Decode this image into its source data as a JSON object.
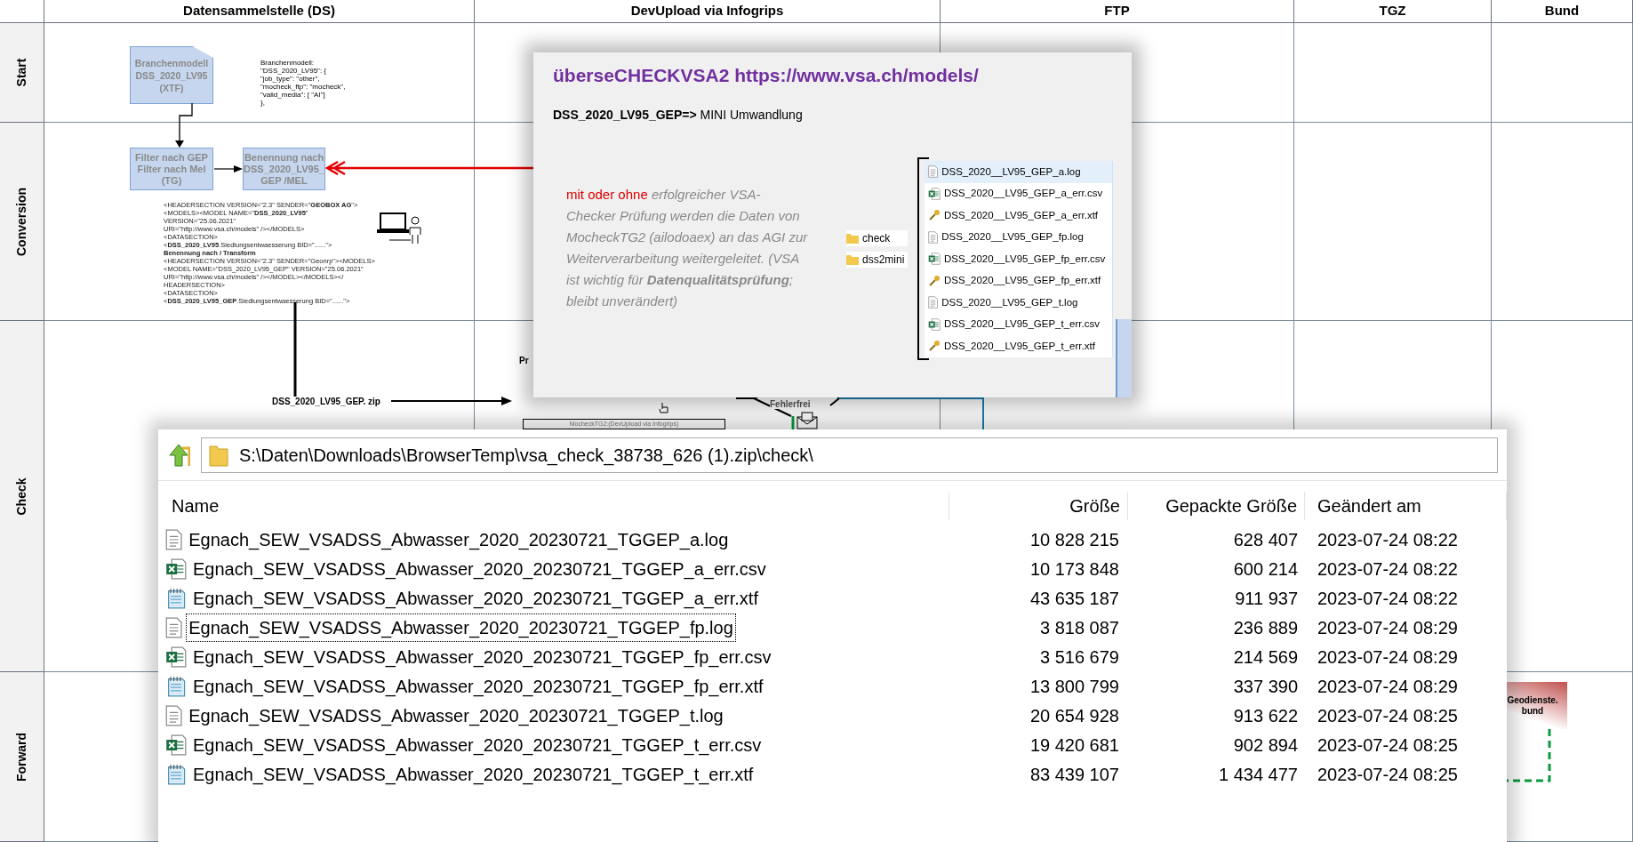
{
  "lanes": {
    "columns": [
      "Datensammelstelle (DS)",
      "DevUpload via Infogrips",
      "FTP",
      "TGZ",
      "Bund"
    ],
    "rows": [
      "Start",
      "Conversion",
      "Check",
      "Forward"
    ]
  },
  "start": {
    "document": [
      "Branchenmodell",
      "DSS_2020_LV95",
      "(XTF)"
    ],
    "config": [
      "Branchenmodell:",
      "\"DSS_2020_LV95\": {",
      "\"job_type\": \"other\",",
      "\"mocheck_ftp\": \"mocheck\",",
      "\"valid_media\": [ \"AI\"]",
      "},"
    ]
  },
  "conversion": {
    "filter_box": [
      "Filter nach GEP",
      "Filter nach Mel",
      "(TG)"
    ],
    "naming_box": [
      "Benennung nach",
      "DSS_2020_LV95_",
      "GEP /MEL"
    ],
    "xml": [
      "<HEADERSECTION VERSION=\"2.3\" SENDER=\"**GEOBOX AG**\">",
      "<MODELS><MODEL NAME=\"**DSS_2020_LV95**\"",
      "VERSION=\"25.06.2021\"",
      "URI=\"http://www.vsa.ch/models\" /></MODELS>",
      "<DATASECTION>",
      "<**DSS_2020_LV95**.Siedlungsentwaesserung BID=\"......\">",
      "**Benennung nach / Transform**",
      "<HEADERSECTION VERSION=\"2.3\" SENDER=\"Geonrp\"><MODELS>",
      "<MODEL NAME=\"DSS_2020_LV95_GEP\" VERSION=\"25.06.2021\"",
      "URI=\"http://www.vsa.ch/models\" /></MODEL></MODELS></",
      "HEADERSECTION>",
      "<DATASECTION>",
      "<**DSS_2020_LV95_GEP**.Siedlungsentwaesserung BID=\"......\">"
    ]
  },
  "check": {
    "zip_label": "DSS_2020_LV95_GEP. zip",
    "partial_title": "Pr",
    "decision": "Fehlerfrei",
    "process_label": "MocheckTG2:(DevUpload via Infogrips)"
  },
  "forward": {
    "target": [
      "Geodienste.",
      "bund"
    ]
  },
  "popup": {
    "title": "überseCHECKVSA2 https://www.vsa.ch/models/",
    "subtitle_bold": "DSS_2020_LV95_GEP=>",
    "subtitle": " MINI Umwandlung",
    "note_lead": "mit oder ohne",
    "note": " erfolgreicher VSA-Checker Prüfung werden die Daten von MocheckTG2 (ailodoaex) an das AGI zur Weiterverarbeitung weitergeleitet. (VSA ist wichtig für **Datenqualitätsprüfung**; bleibt unverändert)",
    "folders": [
      "check",
      "dss2mini"
    ],
    "files": [
      {
        "name": "DSS_2020__LV95_GEP_a.log",
        "kind": "log",
        "selected": true
      },
      {
        "name": "DSS_2020__LV95_GEP_a_err.csv",
        "kind": "csv",
        "selected": false
      },
      {
        "name": "DSS_2020__LV95_GEP_a_err.xtf",
        "kind": "xtf",
        "selected": false
      },
      {
        "name": "DSS_2020__LV95_GEP_fp.log",
        "kind": "log",
        "selected": false
      },
      {
        "name": "DSS_2020__LV95_GEP_fp_err.csv",
        "kind": "csv",
        "selected": false
      },
      {
        "name": "DSS_2020__LV95_GEP_fp_err.xtf",
        "kind": "xtf",
        "selected": false
      },
      {
        "name": "DSS_2020__LV95_GEP_t.log",
        "kind": "log",
        "selected": false
      },
      {
        "name": "DSS_2020__LV95_GEP_t_err.csv",
        "kind": "csv",
        "selected": false
      },
      {
        "name": "DSS_2020__LV95_GEP_t_err.xtf",
        "kind": "xtf",
        "selected": false
      }
    ]
  },
  "explorer": {
    "path": "S:\\Daten\\Downloads\\BrowserTemp\\vsa_check_38738_626 (1).zip\\check\\",
    "columns": [
      "Name",
      "Größe",
      "Gepackte Größe",
      "Geändert am"
    ],
    "rows": [
      {
        "name": "Egnach_SEW_VSADSS_Abwasser_2020_20230721_TGGEP_a.log",
        "kind": "log",
        "size": "10 828 215",
        "packed": "628 407",
        "modified": "2023-07-24 08:22",
        "focused": false
      },
      {
        "name": "Egnach_SEW_VSADSS_Abwasser_2020_20230721_TGGEP_a_err.csv",
        "kind": "csv",
        "size": "10 173 848",
        "packed": "600 214",
        "modified": "2023-07-24 08:22",
        "focused": false
      },
      {
        "name": "Egnach_SEW_VSADSS_Abwasser_2020_20230721_TGGEP_a_err.xtf",
        "kind": "xtf",
        "size": "43 635 187",
        "packed": "911 937",
        "modified": "2023-07-24 08:22",
        "focused": false
      },
      {
        "name": "Egnach_SEW_VSADSS_Abwasser_2020_20230721_TGGEP_fp.log",
        "kind": "log",
        "size": "3 818 087",
        "packed": "236 889",
        "modified": "2023-07-24 08:29",
        "focused": true
      },
      {
        "name": "Egnach_SEW_VSADSS_Abwasser_2020_20230721_TGGEP_fp_err.csv",
        "kind": "csv",
        "size": "3 516 679",
        "packed": "214 569",
        "modified": "2023-07-24 08:29",
        "focused": false
      },
      {
        "name": "Egnach_SEW_VSADSS_Abwasser_2020_20230721_TGGEP_fp_err.xtf",
        "kind": "xtf",
        "size": "13 800 799",
        "packed": "337 390",
        "modified": "2023-07-24 08:29",
        "focused": false
      },
      {
        "name": "Egnach_SEW_VSADSS_Abwasser_2020_20230721_TGGEP_t.log",
        "kind": "log",
        "size": "20 654 928",
        "packed": "913 622",
        "modified": "2023-07-24 08:25",
        "focused": false
      },
      {
        "name": "Egnach_SEW_VSADSS_Abwasser_2020_20230721_TGGEP_t_err.csv",
        "kind": "csv",
        "size": "19 420 681",
        "packed": "902 894",
        "modified": "2023-07-24 08:25",
        "focused": false
      },
      {
        "name": "Egnach_SEW_VSADSS_Abwasser_2020_20230721_TGGEP_t_err.xtf",
        "kind": "xtf",
        "size": "83 439 107",
        "packed": "1 434 477",
        "modified": "2023-07-24 08:25",
        "focused": false
      }
    ]
  }
}
